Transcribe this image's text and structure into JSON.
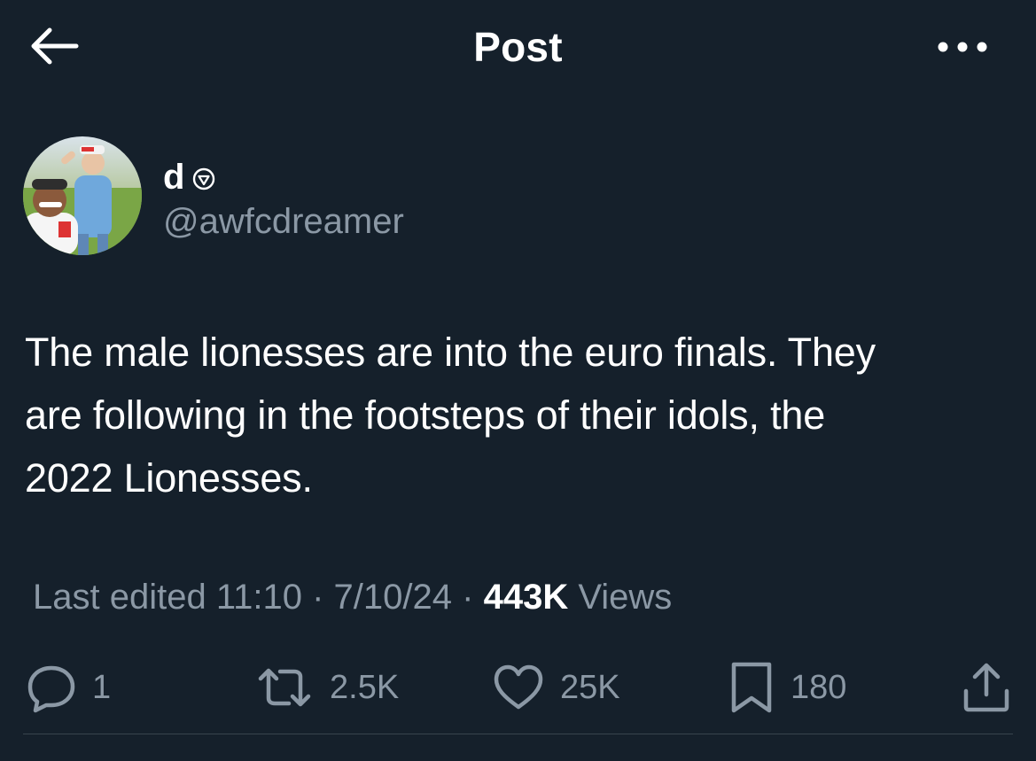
{
  "header": {
    "title": "Post",
    "back_icon": "arrow-left-icon",
    "more_icon": "more-horizontal-icon"
  },
  "author": {
    "display_name": "d",
    "badge_icon": "heart-shield-icon",
    "handle": "@awfcdreamer"
  },
  "tweet": {
    "lines": [
      "The male lionesses are into the euro finals. They",
      "are following in the footsteps of their idols, the",
      "2022 Lionesses."
    ]
  },
  "meta": {
    "edited_label": "Last edited 11:10",
    "separator": "·",
    "date": "7/10/24",
    "views_count": "443K",
    "views_label": "Views"
  },
  "actions": {
    "reply_count": "1",
    "repost_count": "2.5K",
    "like_count": "25K",
    "bookmark_count": "180"
  },
  "colors": {
    "background": "#15202b",
    "text_primary": "#ffffff",
    "text_secondary": "#8b98a5",
    "divider": "#38444d"
  }
}
